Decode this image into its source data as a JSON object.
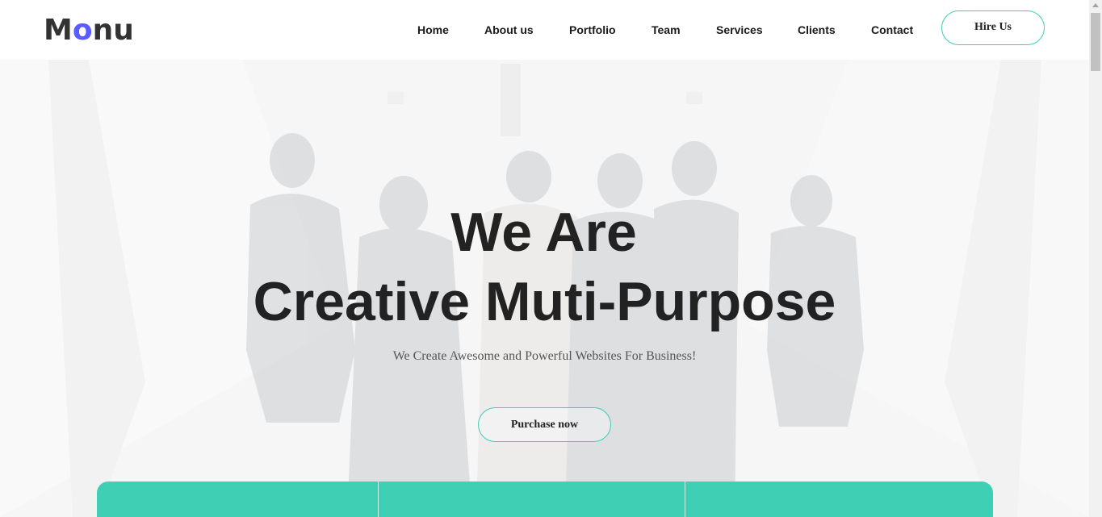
{
  "brand": {
    "logo_prefix": "M",
    "logo_accent": "o",
    "logo_suffix": "nu",
    "accent_color": "#5a5cff"
  },
  "nav": {
    "items": [
      "Home",
      "About us",
      "Portfolio",
      "Team",
      "Services",
      "Clients",
      "Contact"
    ],
    "hire_label": "Hire Us"
  },
  "hero": {
    "headline_line1": "We Are",
    "headline_line2": "Creative Muti-Purpose",
    "tagline": "We Create Awesome and Powerful Websites For Business!",
    "cta_label": "Purchase now",
    "background_image": "business-people-walking-photo"
  },
  "theme": {
    "teal": "#3ecfb5",
    "text_dark": "#222222"
  }
}
